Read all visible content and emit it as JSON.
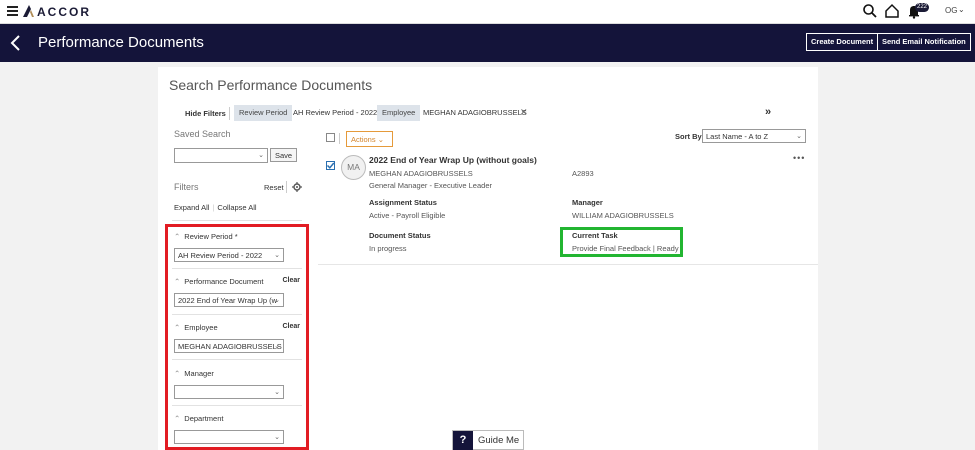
{
  "topbar": {
    "brand": "ACCOR",
    "notification_count": "222",
    "user_initials": "OG"
  },
  "header": {
    "title": "Performance Documents",
    "create_document": "Create Document",
    "send_email": "Send Email Notification"
  },
  "search": {
    "title": "Search Performance Documents",
    "hide_filters": "Hide Filters",
    "chips": [
      {
        "key": "Review Period",
        "value": "AH Review Period - 2022"
      },
      {
        "key": "Employee",
        "value": "MEGHAN ADAGIOBRUSSELS"
      }
    ],
    "more": "»"
  },
  "saved_search": {
    "label": "Saved Search",
    "value": "",
    "save": "Save"
  },
  "filters": {
    "label": "Filters",
    "reset": "Reset",
    "expand_all": "Expand All",
    "collapse_all": "Collapse All",
    "sections": [
      {
        "label": "Review Period *",
        "value": "AH Review Period - 2022",
        "clear": ""
      },
      {
        "label": "Performance Document",
        "value": "2022 End of Year Wrap Up (w",
        "clear": "Clear"
      },
      {
        "label": "Employee",
        "value": "MEGHAN ADAGIOBRUSSELS",
        "clear": "Clear"
      },
      {
        "label": "Manager",
        "value": "",
        "clear": ""
      },
      {
        "label": "Department",
        "value": "",
        "clear": ""
      }
    ]
  },
  "results": {
    "actions": "Actions",
    "sort_label": "Sort By",
    "sort_value": "Last Name - A to Z",
    "items": [
      {
        "avatar": "MA",
        "title": "2022 End of Year Wrap Up (without goals)",
        "employee": "MEGHAN ADAGIOBRUSSELS",
        "id": "A2893",
        "position": "General Manager - Executive Leader",
        "assignment_status_label": "Assignment Status",
        "assignment_status": "Active - Payroll Eligible",
        "manager_label": "Manager",
        "manager": "WILLIAM ADAGIOBRUSSELS",
        "document_status_label": "Document Status",
        "document_status": "In progress",
        "current_task_label": "Current Task",
        "current_task": "Provide Final Feedback | Ready"
      }
    ]
  },
  "guide": {
    "q": "?",
    "label": "Guide Me"
  },
  "colors": {
    "header_bg": "#14143a",
    "highlight_red": "#e21c23",
    "highlight_green": "#22b531",
    "actions_orange": "#e59a3a"
  }
}
